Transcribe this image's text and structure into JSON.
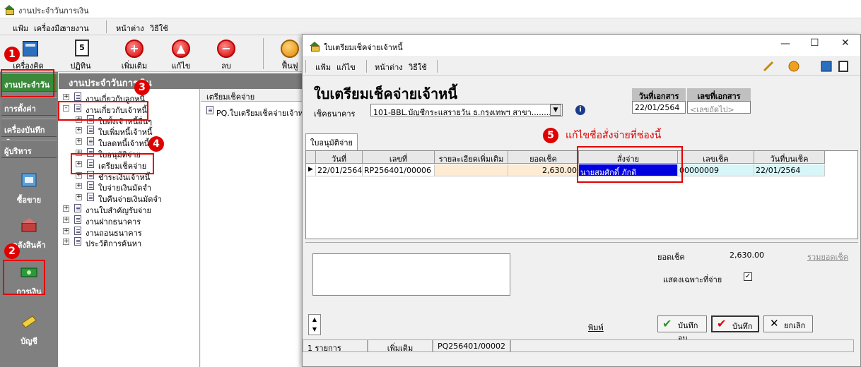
{
  "app": {
    "title": "งานประจำวันการเงิน",
    "menu": [
      "แฟ้ม",
      "เครื่องมือ",
      "รายงาน",
      "หน้าต่าง",
      "วิธีใช้"
    ],
    "toolbar": [
      {
        "label": "เครื่องคิดเลข",
        "icon": "calculator-icon"
      },
      {
        "label": "ปฏิทิน",
        "icon": "calendar-icon"
      },
      {
        "label": "เพิ่มเติม",
        "icon": "add-icon"
      },
      {
        "label": "แก้ไข",
        "icon": "edit-icon"
      },
      {
        "label": "ลบ",
        "icon": "delete-icon"
      },
      {
        "label": "ฟื้นฟู",
        "icon": "refresh-icon"
      }
    ],
    "leftnav": {
      "buttons": [
        "งานประจำวัน",
        "การตั้งค่า",
        "เครื่องบันทึกเงิน",
        "ผู้บริหาร"
      ],
      "icons": [
        "ซื้อขาย",
        "คลังสินค้า",
        "การเงิน",
        "บัญชี"
      ]
    },
    "tree_header": "งานประจำวันการเงิน",
    "tree": [
      {
        "label": "งานเกี่ยวกับลูกหนี้",
        "level": 0,
        "exp": "+"
      },
      {
        "label": "งานเกี่ยวกับเจ้าหนี้",
        "level": 0,
        "exp": "-"
      },
      {
        "label": "ใบตั้งเจ้าหนี้อื่นๆ",
        "level": 1,
        "exp": "+"
      },
      {
        "label": "ใบเพิ่มหนี้เจ้าหนี้",
        "level": 1,
        "exp": "+"
      },
      {
        "label": "ใบลดหนี้เจ้าหนี้",
        "level": 1,
        "exp": "+"
      },
      {
        "label": "ใบอนุมัติจ่าย",
        "level": 1,
        "exp": "+"
      },
      {
        "label": "เตรียมเช็คจ่าย",
        "level": 1,
        "exp": "+"
      },
      {
        "label": "ชำระเงินเจ้าหนี้",
        "level": 1,
        "exp": "+"
      },
      {
        "label": "ใบจ่ายเงินมัดจำ",
        "level": 1,
        "exp": "+"
      },
      {
        "label": "ใบคืนจ่ายเงินมัดจำ",
        "level": 1,
        "exp": "+"
      },
      {
        "label": "งานใบสำคัญรับจ่าย",
        "level": 0,
        "exp": "+"
      },
      {
        "label": "งานฝากธนาคาร",
        "level": 0,
        "exp": "+"
      },
      {
        "label": "งานถอนธนาคาร",
        "level": 0,
        "exp": "+"
      },
      {
        "label": "ประวัติการค้นหา",
        "level": 0,
        "exp": "+"
      }
    ],
    "list": {
      "header": "เตรียมเช็คจ่าย",
      "item": "PQ.ใบเตรียมเช็คจ่ายเจ้าหนี้"
    }
  },
  "dialog": {
    "title": "ใบเตรียมเช็คจ่ายเจ้าหนี้",
    "menu": [
      "แฟ้ม",
      "แก้ไข",
      "หน้าต่าง",
      "วิธีใช้"
    ],
    "form_title": "ใบเตรียมเช็คจ่ายเจ้าหนี้",
    "bank_label": "เช็คธนาคาร",
    "bank_value": "101-BBL.บัญชีกระแสรายวัน ธ.กรุงเทพฯ สาขา........",
    "doc_date_label": "วันที่เอกสาร",
    "doc_date": "22/01/2564",
    "doc_no_label": "เลขที่เอกสาร",
    "doc_no_placeholder": "<เลขถัดไป>",
    "tab": "ใบอนุมัติจ่าย",
    "columns": [
      "วันที่",
      "เลขที่",
      "รายละเอียดเพิ่มเติม",
      "ยอดเช็ค",
      "สั่งจ่าย",
      "เลขเช็ค",
      "วันที่บนเช็ค"
    ],
    "row": [
      "22/01/2564",
      "RP256401/00006",
      "",
      "2,630.00",
      "นายสมศักดิ์ ภักดิ",
      "00000009",
      "22/01/2564"
    ],
    "total_label": "ยอดเช็ค",
    "total_value": "2,630.00",
    "sum_link": "รวมยอดเช็ค",
    "show_only_label": "แสดงเฉพาะที่จ่าย",
    "show_only_checked": true,
    "print_label": "พิมพ์",
    "btn_save_close": "บันทึกจบ",
    "btn_save": "บันทึก",
    "btn_cancel": "ยกเลิก",
    "status": [
      "1 รายการ",
      "เพิ่มเติม",
      "PQ256401/00002"
    ]
  },
  "annotations": {
    "badges": [
      "1",
      "2",
      "3",
      "4",
      "5"
    ],
    "note": "แก้ไขชื่อสั่งจ่ายที่ช่องนี้",
    "color": "#e00000"
  }
}
